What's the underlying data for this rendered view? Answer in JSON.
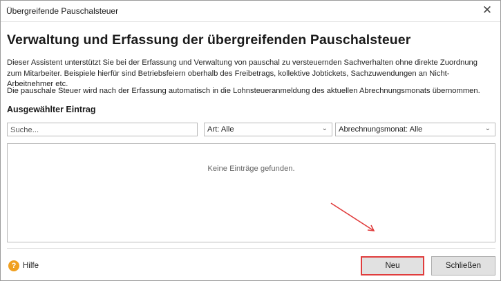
{
  "window": {
    "title": "Übergreifende Pauschalsteuer",
    "close_glyph": "✕"
  },
  "heading": "Verwaltung und Erfassung der übergreifenden Pauschalsteuer",
  "description": "Dieser Assistent unterstützt Sie bei der Erfassung und Verwaltung von pauschal zu versteuernden Sachverhalten ohne direkte Zuordnung zum Mitarbeiter. Beispiele hierfür sind Betriebsfeiern oberhalb des Freibetrags, kollektive Jobtickets, Sachzuwendungen an Nicht-Arbeitnehmer etc.",
  "description2": "Die pauschale Steuer wird nach der Erfassung automatisch in die Lohnsteueranmeldung des aktuellen Abrechnungsmonats übernommen.",
  "section_title": "Ausgewählter Eintrag",
  "search": {
    "placeholder": "Suche...",
    "value": ""
  },
  "filters": {
    "art": {
      "selected": "Art: Alle"
    },
    "month": {
      "selected": "Abrechnungsmonat: Alle"
    }
  },
  "list": {
    "empty_text": "Keine Einträge gefunden."
  },
  "footer": {
    "help_label": "Hilfe",
    "help_glyph": "?",
    "new_label": "Neu",
    "close_label": "Schließen"
  },
  "colors": {
    "highlight": "#e03c3c",
    "help_icon": "#f0a020",
    "button_bg": "#e1e1e1"
  },
  "icons": {
    "close": "close-icon",
    "help": "help-icon",
    "dropdown": "chevron-down-icon",
    "annotation": "arrow-annotation"
  }
}
